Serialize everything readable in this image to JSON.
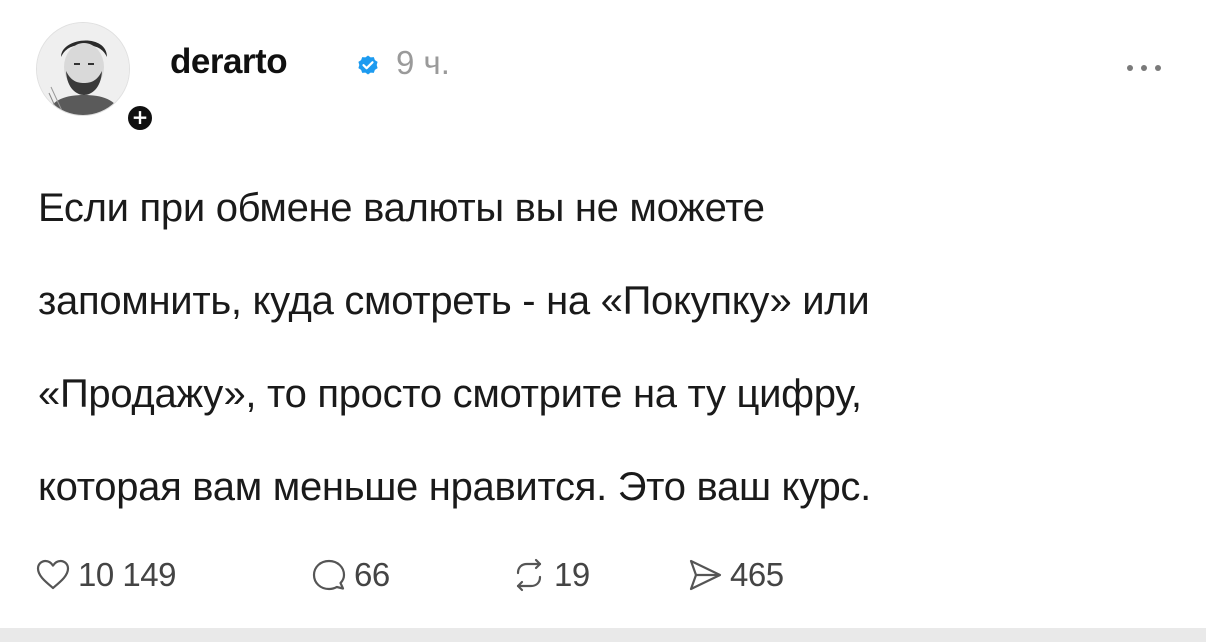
{
  "post": {
    "author": {
      "username": "derarto",
      "verified": true,
      "avatar_icon": "avatar-portrait",
      "follow_icon": "plus-icon",
      "follow_glyph": "+"
    },
    "timestamp": "9 ч.",
    "more_icon": "ellipsis-icon",
    "text_lines": [
      "Если при обмене валюты вы не можете",
      "запомнить, куда смотреть - на «Покупку» или",
      "«Продажу», то просто смотрите на ту цифру,",
      "которая вам меньше нравится. Это ваш курс."
    ],
    "actions": {
      "likes": "10 149",
      "comments": "66",
      "reposts": "19",
      "shares": "465"
    }
  },
  "colors": {
    "accent_verified": "#1d9bf0",
    "text_primary": "#1a1a1a",
    "text_muted": "#9a9a9a"
  }
}
